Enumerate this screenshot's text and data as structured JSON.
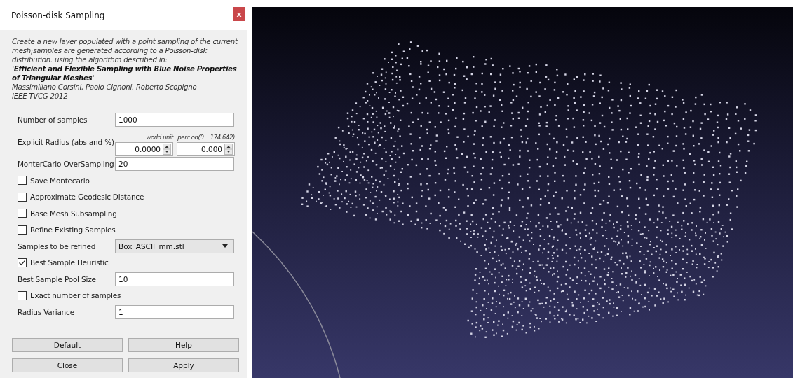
{
  "window": {
    "title": "Poisson-disk Sampling",
    "close": "x"
  },
  "description": {
    "text": "Create a new layer populated with a point sampling of the current mesh;samples are generated according to a Poisson-disk distribution. using the algorithm described in:",
    "paper_title": "'Efficient and Flexible Sampling with Blue Noise Properties of Triangular Meshes'",
    "authors": "Massimiliano Corsini, Paolo Cignoni, Roberto Scopigno",
    "venue": "IEEE TVCG 2012"
  },
  "parameters": [
    {
      "kind": "text",
      "label": "Number of samples",
      "value": "1000"
    },
    {
      "kind": "radius",
      "label": "Explicit Radius (abs and %)",
      "fields": [
        {
          "caption": "world unit",
          "value": "0.0000"
        },
        {
          "caption": "perc on(0 .. 174.642)",
          "value": "0.000"
        }
      ]
    },
    {
      "kind": "text",
      "label": "MonterCarlo OverSampling",
      "value": "20"
    },
    {
      "kind": "checkbox",
      "label": "Save Montecarlo",
      "checked": false
    },
    {
      "kind": "checkbox",
      "label": "Approximate Geodesic Distance",
      "checked": false
    },
    {
      "kind": "checkbox",
      "label": "Base Mesh Subsampling",
      "checked": false
    },
    {
      "kind": "checkbox",
      "label": "Refine Existing Samples",
      "checked": false
    },
    {
      "kind": "dropdown",
      "label": "Samples to be refined",
      "value": "Box_ASCII_mm.stl"
    },
    {
      "kind": "checkbox",
      "label": "Best Sample Heuristic",
      "checked": true
    },
    {
      "kind": "text",
      "label": "Best Sample Pool Size",
      "value": "10"
    },
    {
      "kind": "checkbox",
      "label": "Exact number of samples",
      "checked": false
    },
    {
      "kind": "text",
      "label": "Radius Variance",
      "value": "1"
    }
  ],
  "buttons": [
    "Default",
    "Help",
    "Close",
    "Apply"
  ]
}
